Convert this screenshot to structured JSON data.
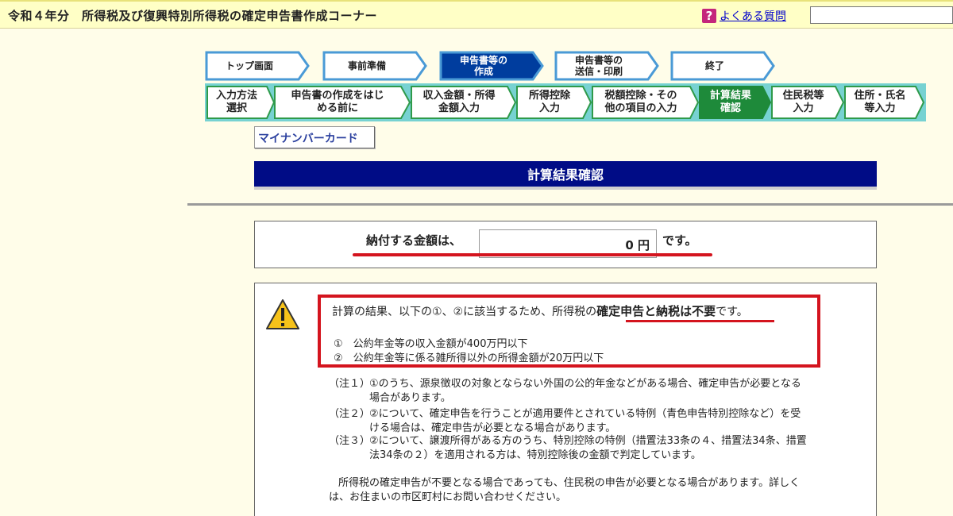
{
  "header": {
    "title": "令和４年分　所得税及び復興特別所得税の確定申告書作成コーナー",
    "faq_icon": "?",
    "faq_label": "よくある質問",
    "search_value": ""
  },
  "steps_main": [
    {
      "label": "トップ画面",
      "state": "done"
    },
    {
      "label": "事前準備",
      "state": "done"
    },
    {
      "label": "申告書等の\n作成",
      "state": "active"
    },
    {
      "label": "申告書等の\n送信・印刷",
      "state": "todo"
    },
    {
      "label": "終了",
      "state": "todo"
    }
  ],
  "steps_sub": [
    {
      "label": "入力方法\n選択",
      "state": "done"
    },
    {
      "label": "申告書の作成をはじ\nめる前に",
      "state": "done"
    },
    {
      "label": "収入金額・所得\n金額入力",
      "state": "done"
    },
    {
      "label": "所得控除\n入力",
      "state": "done"
    },
    {
      "label": "税額控除・その\n他の項目の入力",
      "state": "done"
    },
    {
      "label": "計算結果\n確認",
      "state": "active"
    },
    {
      "label": "住民税等\n入力",
      "state": "todo"
    },
    {
      "label": "住所・氏名\n等入力",
      "state": "todo"
    }
  ],
  "mynumber_button": "マイナンバーカード",
  "page_title": "計算結果確認",
  "payment": {
    "label": "納付する金額は、",
    "amount": "0 円",
    "suffix": "です。"
  },
  "result": {
    "main_prefix": "計算の結果、以下の①、②に該当するため、所得税の",
    "main_emphasis": "確定申告と納税は不要",
    "main_suffix": "です。",
    "conditions": [
      "①　公約年金等の収入金額が400万円以下",
      "②　公約年金等に係る雑所得以外の所得金額が20万円以下"
    ]
  },
  "notes": [
    {
      "marker": "（注１）",
      "lines": [
        "①のうち、源泉徴収の対象とならない外国の公的年金などがある場合、確定申告が必要となる",
        "場合があります。"
      ]
    },
    {
      "marker": "（注２）",
      "lines": [
        "②について、確定申告を行うことが適用要件とされている特例（青色申告特別控除など）を受",
        "ける場合は、確定申告が必要となる場合があります。"
      ]
    },
    {
      "marker": "（注３）",
      "lines": [
        "②について、譲渡所得がある方のうち、特別控除の特例（措置法33条の４、措置法34条、措置",
        "法34条の２）を適用される方は、特別控除後の金額で判定しています。"
      ]
    }
  ],
  "footer_note": [
    "所得税の確定申告が不要となる場合であっても、住民税の申告が必要となる場合があります。詳しく",
    "は、お住まいの市区町村にお問い合わせください。"
  ],
  "colors": {
    "active_step": "#003d9e",
    "done_step_fill": "#ffffff",
    "done_step_stroke": "#4a9ad6",
    "sub_active": "#1e8a3a",
    "sub_frame": "#77d2d2",
    "title_bar": "#000c86",
    "emphasis_red": "#d4141e"
  }
}
